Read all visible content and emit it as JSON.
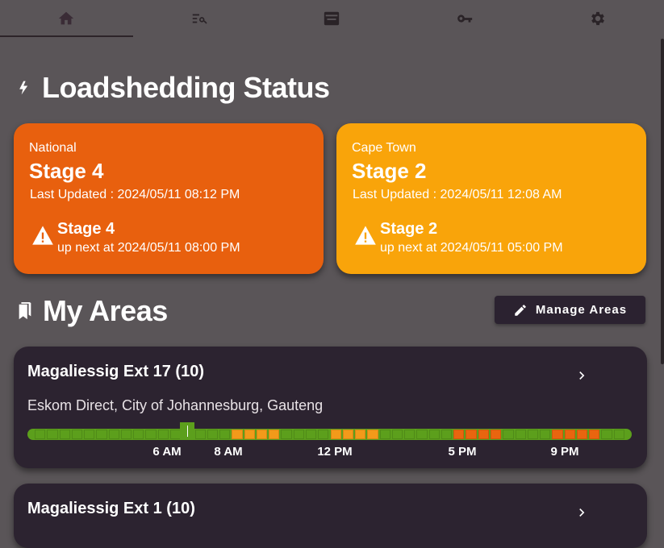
{
  "tabs": [
    {
      "icon": "home-icon",
      "active": true
    },
    {
      "icon": "search-list-icon",
      "active": false
    },
    {
      "icon": "message-icon",
      "active": false
    },
    {
      "icon": "key-icon",
      "active": false
    },
    {
      "icon": "gear-icon",
      "active": false
    }
  ],
  "status": {
    "title": "Loadshedding Status",
    "icon": "lightning-icon",
    "national": {
      "area": "National",
      "stage": "Stage 4",
      "updated": "Last Updated : 2024/05/11 08:12 PM",
      "next_stage": "Stage 4",
      "next_time": "up next at 2024/05/11 08:00 PM",
      "color": "#e8600e"
    },
    "region": {
      "area": "Cape Town",
      "stage": "Stage 2",
      "updated": "Last Updated : 2024/05/11 12:08 AM",
      "next_stage": "Stage 2",
      "next_time": "up next at 2024/05/11 05:00 PM",
      "color": "#f9a40a"
    }
  },
  "areas": {
    "title": "My Areas",
    "icon": "bookmarks-icon",
    "manage_label": "Manage Areas",
    "items": [
      {
        "name": "Magaliessig Ext 17 (10)",
        "info": "Eskom Direct, City of Johannesburg, Gauteng",
        "timeline_labels": [
          "6 AM",
          "8 AM",
          "12 PM",
          "5 PM",
          "9 PM"
        ]
      },
      {
        "name": "Magaliessig Ext 1 (10)"
      }
    ]
  },
  "timeline": {
    "slots": 48,
    "now_slot": 12,
    "outages": [
      {
        "start": 16,
        "end": 20,
        "color": "#f29a1a"
      },
      {
        "start": 24,
        "end": 28,
        "color": "#f29a1a"
      },
      {
        "start": 34,
        "end": 38,
        "color": "#e9650f"
      },
      {
        "start": 42,
        "end": 46,
        "color": "#e9650f"
      }
    ],
    "ok_color": "#5c9f1c"
  }
}
